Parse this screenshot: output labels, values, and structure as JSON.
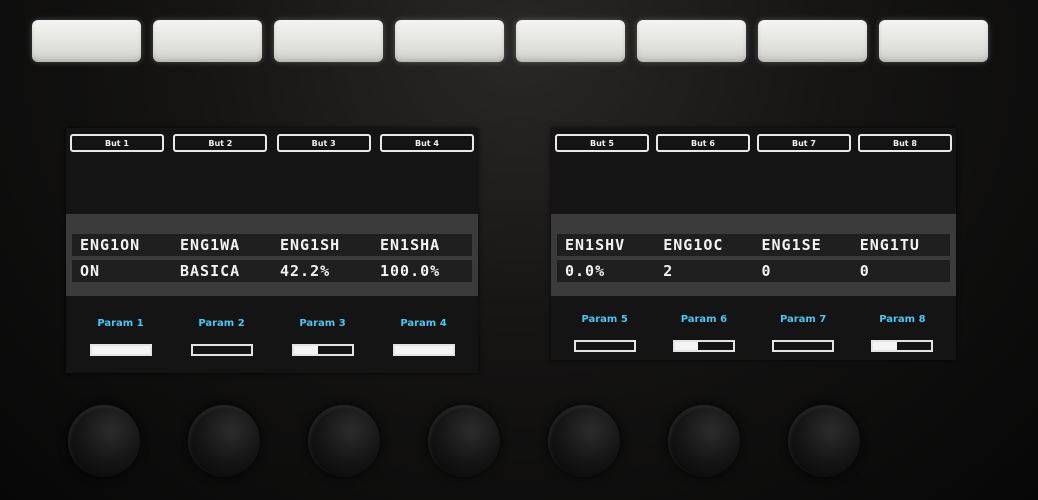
{
  "left_screen": {
    "buttons": [
      "But 1",
      "But 2",
      "But 3",
      "But 4"
    ],
    "param_names": [
      "ENG1ON",
      "ENG1WA",
      "ENG1SH",
      "EN1SHA"
    ],
    "param_values": [
      "ON",
      "BASICA",
      "42.2%",
      "100.0%"
    ],
    "params": [
      {
        "label": "Param 1",
        "level": 1.0
      },
      {
        "label": "Param 2",
        "level": 0.0
      },
      {
        "label": "Param 3",
        "level": 0.42
      },
      {
        "label": "Param 4",
        "level": 1.0
      }
    ]
  },
  "right_screen": {
    "buttons": [
      "But 5",
      "But 6",
      "But 7",
      "But 8"
    ],
    "param_names": [
      "EN1SHV",
      "ENG1OC",
      "ENG1SE",
      "ENG1TU"
    ],
    "param_values": [
      "0.0%",
      "2",
      "0",
      "0"
    ],
    "params": [
      {
        "label": "Param 5",
        "level": 0.0
      },
      {
        "label": "Param 6",
        "level": 0.4
      },
      {
        "label": "Param 7",
        "level": 0.0
      },
      {
        "label": "Param 8",
        "level": 0.4
      }
    ]
  },
  "colors": {
    "param_label": "#49c7f2",
    "screen_bg": "#141414",
    "band": "#3b3b3b"
  }
}
